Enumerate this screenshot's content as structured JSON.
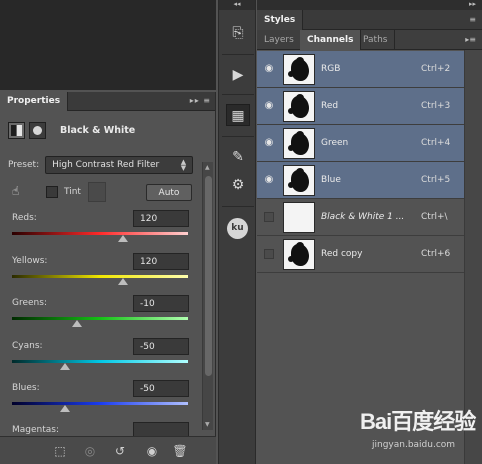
{
  "properties": {
    "tab_label": "Properties",
    "header_icons": "▸▸ ≡",
    "adjustment_title": "Black & White",
    "preset_label": "Preset:",
    "preset_value": "High Contrast Red Filter",
    "tint_label": "Tint",
    "auto_label": "Auto",
    "sliders": [
      {
        "label": "Reds:",
        "value": "120",
        "level": 0.63,
        "gradient": "linear-gradient(to right,#2a0000,#ff2a2a,#ffd0d0)"
      },
      {
        "label": "Yellows:",
        "value": "120",
        "level": 0.63,
        "gradient": "linear-gradient(to right,#2a2a00,#f0e600,#ffffb0)"
      },
      {
        "label": "Greens:",
        "value": "-10",
        "level": 0.37,
        "gradient": "linear-gradient(to right,#002a00,#15c015,#b0ffb0)"
      },
      {
        "label": "Cyans:",
        "value": "-50",
        "level": 0.3,
        "gradient": "linear-gradient(to right,#002a2a,#00c8e6,#b0ffff)"
      },
      {
        "label": "Blues:",
        "value": "-50",
        "level": 0.3,
        "gradient": "linear-gradient(to right,#00002a,#1a3cf0,#b0c0ff)"
      },
      {
        "label": "Magentas:",
        "value": "",
        "level": 0.5,
        "gradient": "linear-gradient(to right,#2a002a,#e020e0,#ffb0ff)"
      }
    ]
  },
  "toolbar": {
    "header": "◂◂"
  },
  "right_panel": {
    "top_header": "▸▸",
    "styles_tab": "Styles",
    "tabs": [
      "Layers",
      "Channels",
      "Paths"
    ],
    "channels": [
      {
        "name": "RGB",
        "shortcut": "Ctrl+2",
        "selected": true,
        "visible": true,
        "kind": "image"
      },
      {
        "name": "Red",
        "shortcut": "Ctrl+3",
        "selected": true,
        "visible": true,
        "kind": "image"
      },
      {
        "name": "Green",
        "shortcut": "Ctrl+4",
        "selected": true,
        "visible": true,
        "kind": "image"
      },
      {
        "name": "Blue",
        "shortcut": "Ctrl+5",
        "selected": true,
        "visible": true,
        "kind": "image"
      },
      {
        "name": "Black & White 1 ...",
        "shortcut": "Ctrl+\\",
        "selected": false,
        "visible": false,
        "kind": "mask-white",
        "italic": true
      },
      {
        "name": "Red copy",
        "shortcut": "Ctrl+6",
        "selected": false,
        "visible": false,
        "kind": "image"
      }
    ]
  },
  "watermark": {
    "brand": "Bai百度经验",
    "url": "jingyan.baidu.com"
  }
}
